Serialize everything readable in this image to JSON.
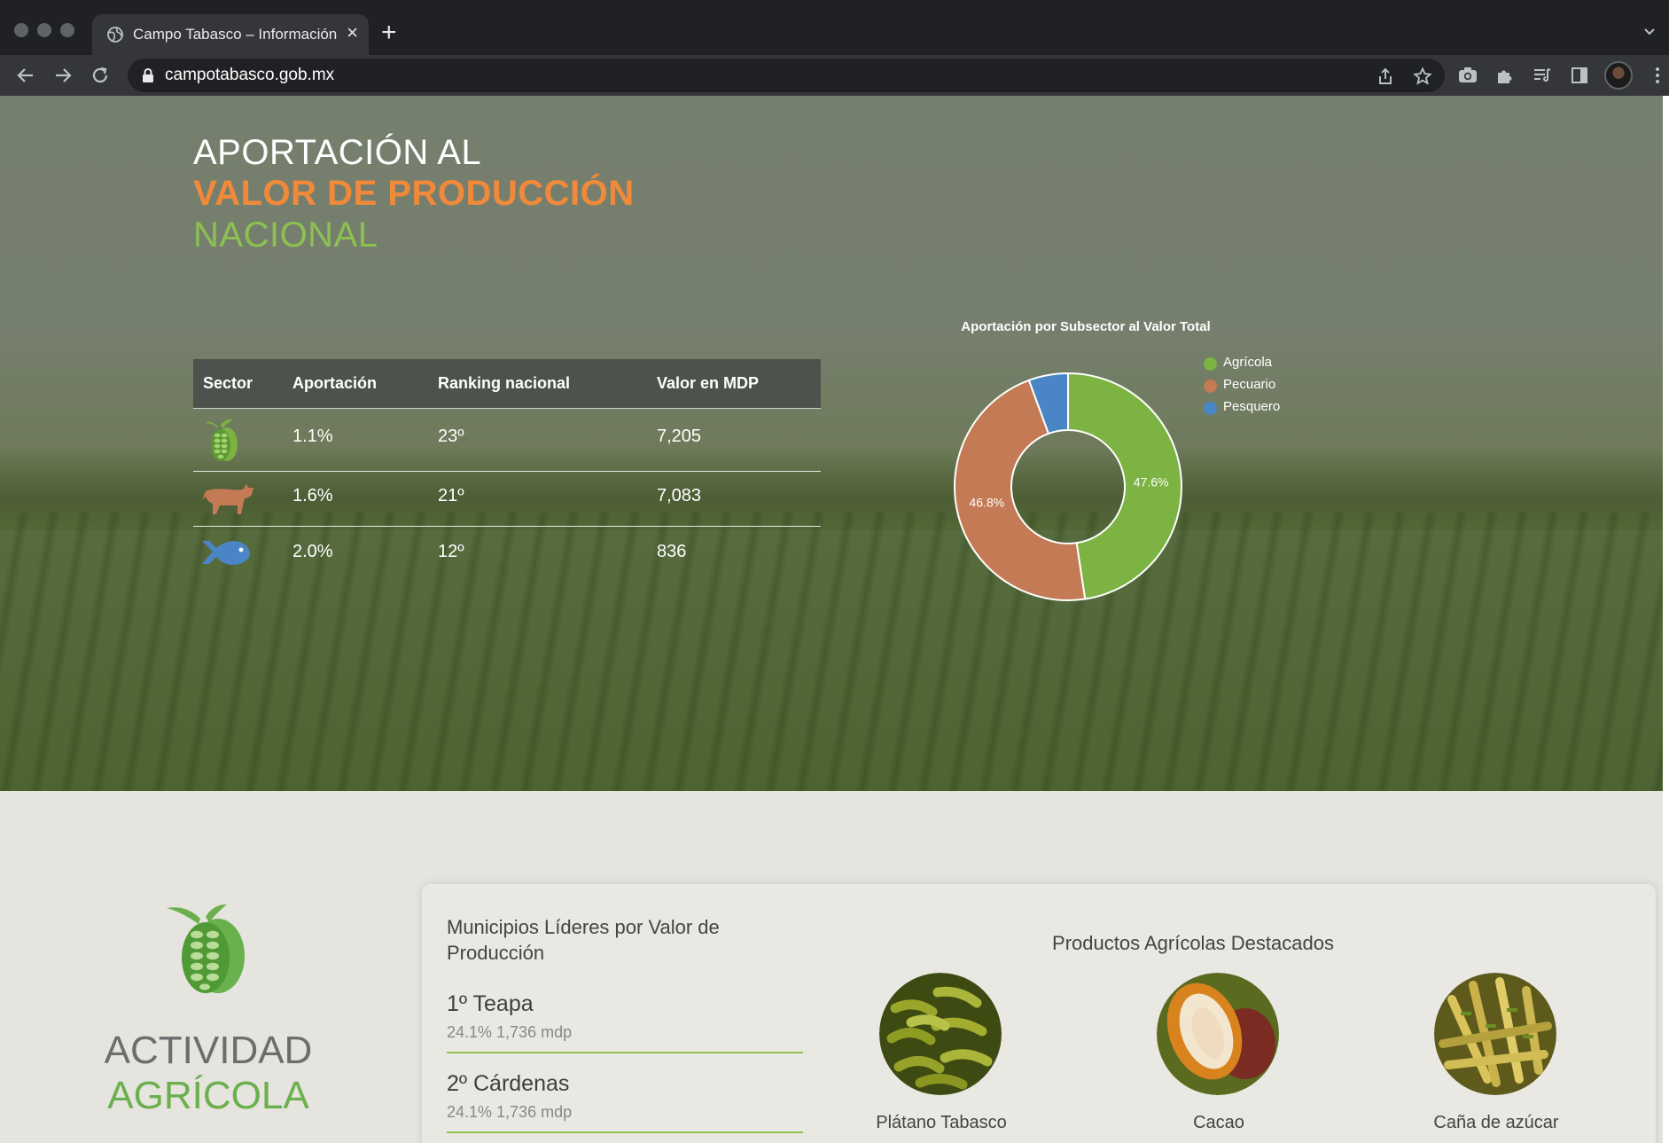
{
  "browser": {
    "tab_title": "Campo Tabasco – Información",
    "url": "campotabasco.gob.mx"
  },
  "hero": {
    "heading_line1": "APORTACIÓN AL",
    "heading_line2": "VALOR DE PRODUCCIÓN",
    "heading_line3": "NACIONAL",
    "table": {
      "headers": [
        "Sector",
        "Aportación",
        "Ranking nacional",
        "Valor en MDP"
      ],
      "rows": [
        {
          "sector_icon": "cacao-pod-icon",
          "aportacion": "1.1%",
          "ranking": "23º",
          "valor": "7,205"
        },
        {
          "sector_icon": "cow-icon",
          "aportacion": "1.6%",
          "ranking": "21º",
          "valor": "7,083"
        },
        {
          "sector_icon": "fish-icon",
          "aportacion": "2.0%",
          "ranking": "12º",
          "valor": "836"
        }
      ]
    }
  },
  "chart_data": {
    "type": "pie",
    "title": "Aportación por Subsector al Valor Total",
    "donut": true,
    "legend_position": "top-right",
    "series": [
      {
        "name": "Agrícola",
        "value": 47.6,
        "label": "47.6%",
        "color": "#7cb342"
      },
      {
        "name": "Pecuario",
        "value": 46.8,
        "label": "46.8%",
        "color": "#c47a54"
      },
      {
        "name": "Pesquero",
        "value": 5.6,
        "label": "",
        "color": "#4a86c5"
      }
    ]
  },
  "agricola": {
    "title_line1": "ACTIVIDAD",
    "title_line2": "AGRÍCOLA",
    "icon": "cacao-pod-icon",
    "municipios_title": "Municipios Líderes por Valor de Producción",
    "municipios": [
      {
        "name": "1º Teapa",
        "detail": "24.1% 1,736 mdp"
      },
      {
        "name": "2º Cárdenas",
        "detail": "24.1% 1,736 mdp"
      }
    ],
    "productos_title": "Productos Agrícolas Destacados",
    "productos": [
      {
        "name": "Plátano Tabasco",
        "image": "banana-bunches-photo"
      },
      {
        "name": "Cacao",
        "image": "cacao-pod-photo"
      },
      {
        "name": "Caña de azúcar",
        "image": "sugar-cane-photo"
      }
    ]
  },
  "colors": {
    "orange_accent": "#f08a3a",
    "green_accent": "#8cc152",
    "table_header_bg": "#4d524c"
  }
}
